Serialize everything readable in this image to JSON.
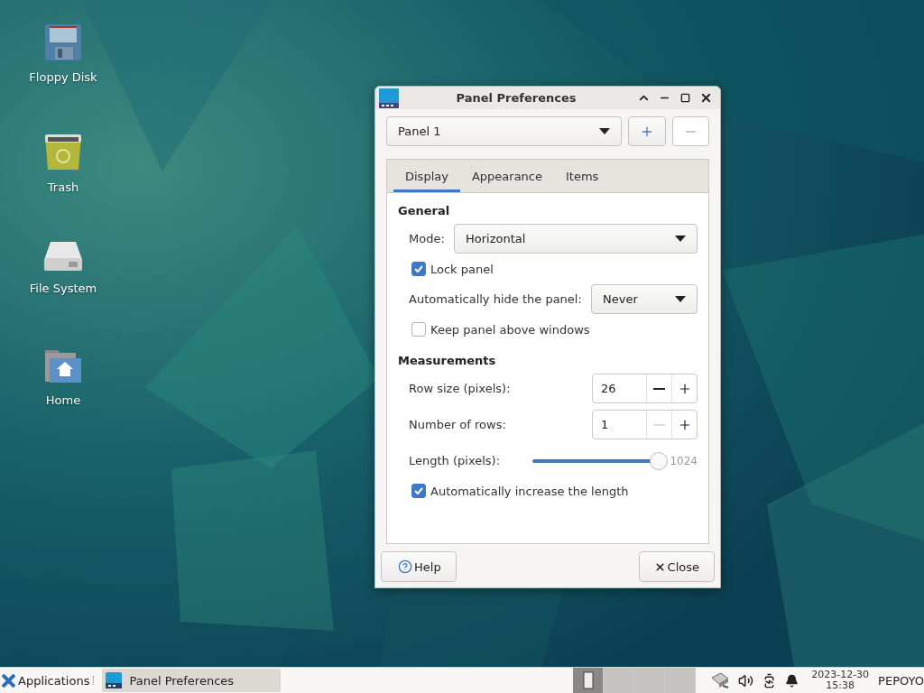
{
  "desktop_icons": [
    {
      "label": "Floppy Disk",
      "kind": "floppy"
    },
    {
      "label": "Trash",
      "kind": "trash"
    },
    {
      "label": "File System",
      "kind": "drive"
    },
    {
      "label": "Home",
      "kind": "home"
    }
  ],
  "window": {
    "title": "Panel Preferences",
    "panel_select": "Panel 1",
    "add_disabled": false,
    "remove_disabled": true,
    "tabs": [
      {
        "label": "Display",
        "selected": true
      },
      {
        "label": "Appearance",
        "selected": false
      },
      {
        "label": "Items",
        "selected": false
      }
    ],
    "general": {
      "heading": "General",
      "mode_label": "Mode:",
      "mode_value": "Horizontal",
      "lock": {
        "label": "Lock panel",
        "checked": true
      },
      "autohide_label": "Automatically hide the panel:",
      "autohide_value": "Never",
      "above": {
        "label": "Keep panel above windows",
        "checked": false
      }
    },
    "measurements": {
      "heading": "Measurements",
      "spinners": [
        {
          "label": "Row size (pixels):",
          "value": "26",
          "minus_disabled": false
        },
        {
          "label": "Number of rows:",
          "value": "1",
          "minus_disabled": true
        }
      ],
      "length": {
        "label": "Length (pixels):",
        "level": 1,
        "reading": "1024"
      },
      "auto_length": {
        "label": "Automatically increase the length",
        "checked": true
      }
    },
    "help_button": "Help",
    "close_button": "Close"
  },
  "taskbar": {
    "applications": "Applications",
    "tasks": [
      {
        "label": "Panel Preferences",
        "selected": true
      }
    ],
    "workspaces": [
      {
        "selected": true
      },
      {
        "selected": false
      },
      {
        "selected": false
      },
      {
        "selected": false
      }
    ],
    "date": "2023-12-30",
    "time": "15:38",
    "user": "PEPOYO"
  }
}
